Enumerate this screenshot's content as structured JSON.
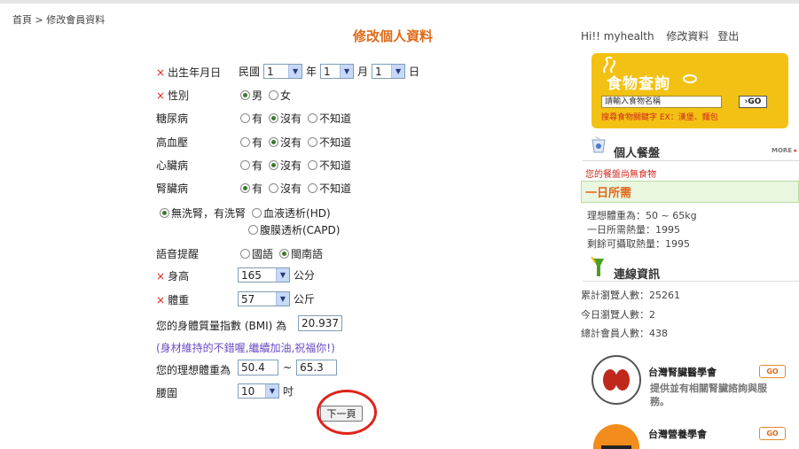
{
  "breadcrumb": {
    "home": "首頁",
    "separator": ">",
    "current": "修改會員資料"
  },
  "title": "修改個人資料",
  "form": {
    "birthday": {
      "label": "出生年月日",
      "era": "民國",
      "year": "1",
      "year_unit": "年",
      "month": "1",
      "month_unit": "月",
      "day": "1",
      "day_unit": "日"
    },
    "gender": {
      "label": "性別",
      "options": [
        "男",
        "女"
      ],
      "selected": "男"
    },
    "diabetes": {
      "label": "糖尿病",
      "options": [
        "有",
        "沒有",
        "不知道"
      ],
      "selected": "沒有"
    },
    "hypertension": {
      "label": "高血壓",
      "options": [
        "有",
        "沒有",
        "不知道"
      ],
      "selected": "沒有"
    },
    "heart": {
      "label": "心臟病",
      "options": [
        "有",
        "沒有",
        "不知道"
      ],
      "selected": "沒有"
    },
    "kidney": {
      "label": "腎臟病",
      "options": [
        "有",
        "沒有",
        "不知道"
      ],
      "selected": "有"
    },
    "dialysis": {
      "options": [
        "無洗腎，有洗腎",
        "血液透析(HD)",
        "腹膜透析(CAPD)"
      ],
      "selected": "無洗腎，有洗腎"
    },
    "voice": {
      "label": "語音提醒",
      "options": [
        "國語",
        "閩南語"
      ],
      "selected": "閩南語"
    },
    "height": {
      "label": "身高",
      "value": "165",
      "unit": "公分"
    },
    "weight": {
      "label": "體重",
      "value": "57",
      "unit": "公斤"
    },
    "bmi": {
      "label": "您的身體質量指數 (BMI) 為",
      "value": "20.937"
    },
    "bmi_note": "(身材維持的不錯喔,繼續加油,祝福你!)",
    "ideal": {
      "label": "您的理想體重為",
      "min": "50.4",
      "sep": "~",
      "max": "65.3"
    },
    "waist": {
      "label": "腰圍",
      "value": "10",
      "unit": "吋"
    },
    "next_button": "下一頁"
  },
  "sidebar": {
    "greeting": "Hi!! myhealth",
    "edit_link": "修改資料",
    "logout_link": "登出",
    "food_search": {
      "title": "食物查詢",
      "placeholder": "請輸入食物名稱",
      "go": "GO",
      "hint": "搜尋食物關鍵字 EX：漢堡、麵包"
    },
    "meal": {
      "title": "個人餐盤",
      "more": "MORE",
      "empty": "您的餐盤尚無食物"
    },
    "daily": {
      "title": "一日所需",
      "lines": [
        "理想體重為：50 ~ 65kg",
        "一日所需熱量：1995",
        "剩餘可攝取熱量：1995"
      ]
    },
    "stats": {
      "title": "連線資訊",
      "lines": [
        "累計瀏覽人數：25261",
        "今日瀏覽人數：2",
        "總計會員人數：438"
      ]
    },
    "partners": [
      {
        "name": "台灣腎臟醫學會",
        "go": "GO",
        "desc": "提供並有相關腎臟諮詢與服務。"
      },
      {
        "name": "台灣營養學會",
        "go": "GO"
      }
    ]
  },
  "colors": {
    "accent_orange": "#e06a1a",
    "required_red": "#e0231b",
    "food_yellow": "#f3c113",
    "highlight_circle": "#e0231b"
  }
}
